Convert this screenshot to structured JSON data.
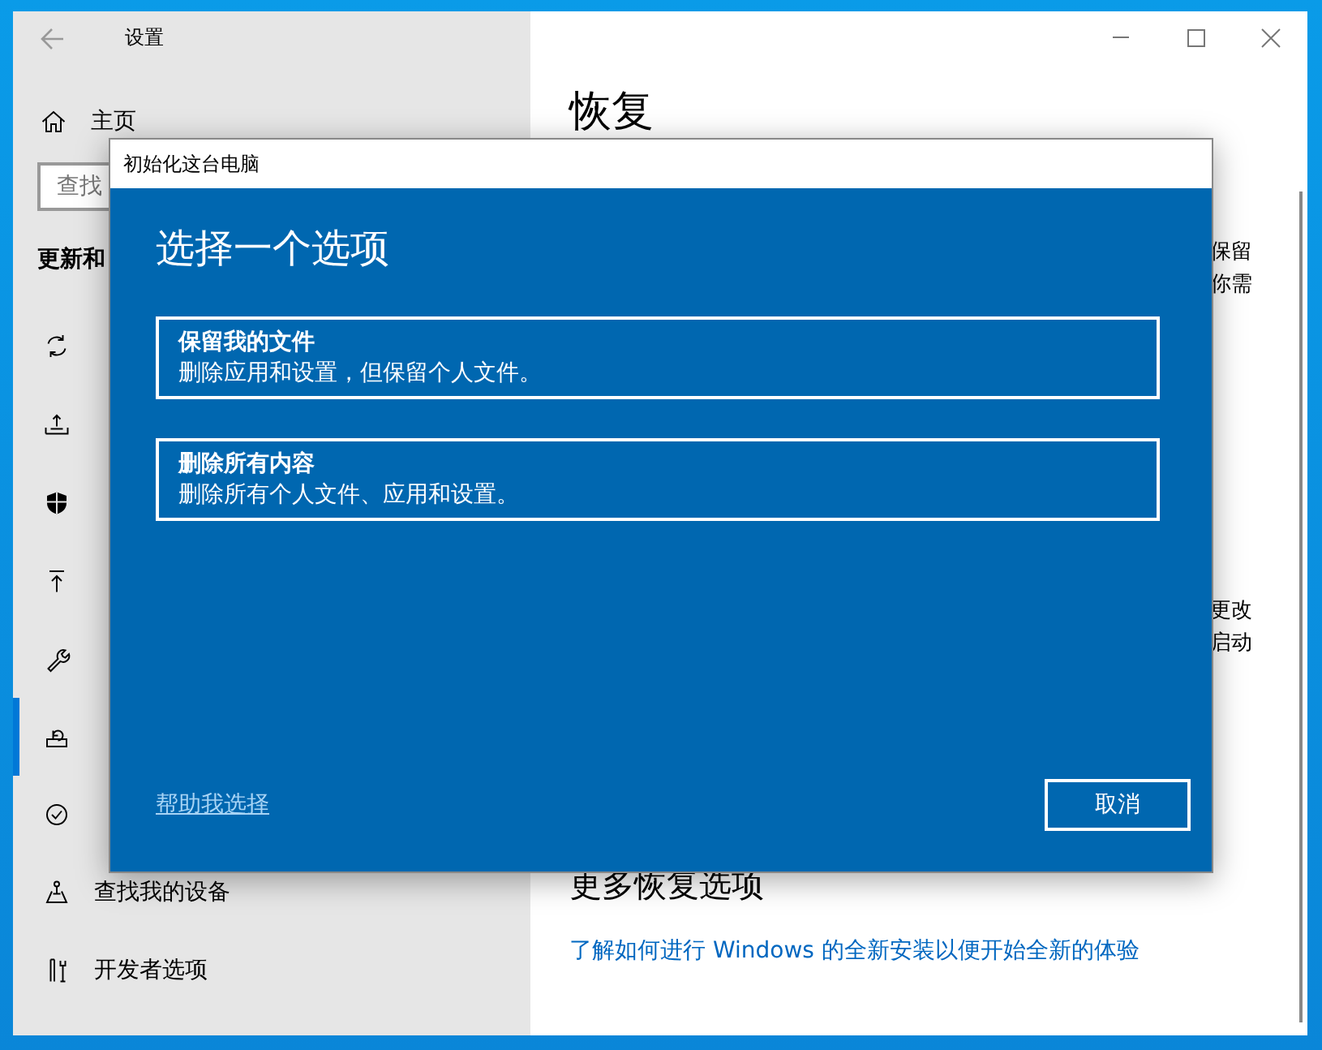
{
  "window": {
    "title": "设置"
  },
  "sidebar": {
    "home": "主页",
    "search": {
      "placeholder": "查找"
    },
    "section": "更新和",
    "items": [
      {
        "selected": false
      },
      {
        "selected": false
      },
      {
        "selected": false
      },
      {
        "selected": false
      },
      {
        "selected": false
      },
      {
        "selected": true
      },
      {
        "selected": false
      },
      {
        "label": "查找我的设备",
        "selected": false
      },
      {
        "label": "开发者选项",
        "selected": false
      }
    ]
  },
  "content": {
    "title": "恢复",
    "fragments": [
      [
        "保留",
        "你需"
      ],
      [
        "更改",
        "启动"
      ]
    ],
    "more_title": "更多恢复选项",
    "link": "了解如何进行 Windows 的全新安装以便开始全新的体验"
  },
  "dialog": {
    "title": "初始化这台电脑",
    "heading": "选择一个选项",
    "options": [
      {
        "title": "保留我的文件",
        "description": "删除应用和设置，但保留个人文件。"
      },
      {
        "title": "删除所有内容",
        "description": "删除所有个人文件、应用和设置。"
      }
    ],
    "help_link": "帮助我选择",
    "cancel": "取消"
  }
}
